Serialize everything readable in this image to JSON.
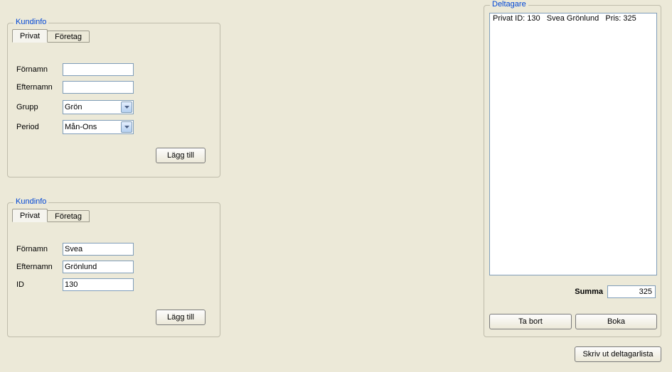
{
  "topPanel": {
    "title": "Kundinfo",
    "tabs": {
      "privat": "Privat",
      "foretag": "Företag"
    },
    "labels": {
      "fornamn": "Förnamn",
      "efternamn": "Efternamn",
      "grupp": "Grupp",
      "period": "Period"
    },
    "values": {
      "fornamn": "",
      "efternamn": "",
      "grupp": "Grön",
      "period": "Mån-Ons"
    },
    "addBtn": "Lägg till"
  },
  "bottomPanel": {
    "title": "Kundinfo",
    "tabs": {
      "privat": "Privat",
      "foretag": "Företag"
    },
    "labels": {
      "fornamn": "Förnamn",
      "efternamn": "Efternamn",
      "id": "ID"
    },
    "values": {
      "fornamn": "Svea",
      "efternamn": "Grönlund",
      "id": "130"
    },
    "addBtn": "Lägg till"
  },
  "deltagare": {
    "title": "Deltagare",
    "items": [
      "Privat ID: 130   Svea Grönlund   Pris: 325"
    ],
    "summaLabel": "Summa",
    "summaValue": "325",
    "removeBtn": "Ta bort",
    "bookBtn": "Boka"
  },
  "printBtn": "Skriv ut deltagarlista"
}
